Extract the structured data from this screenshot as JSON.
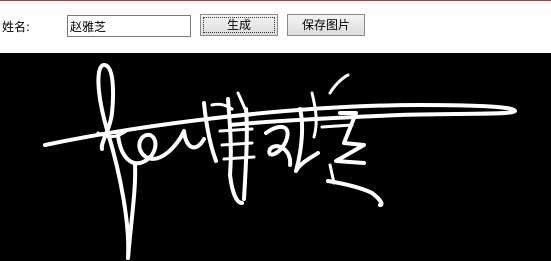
{
  "form": {
    "name_label": "姓名:",
    "name_value": "赵雅芝",
    "generate_label": "生成",
    "save_label": "保存图片"
  },
  "canvas": {
    "background": "#000000",
    "stroke": "#ffffff"
  }
}
